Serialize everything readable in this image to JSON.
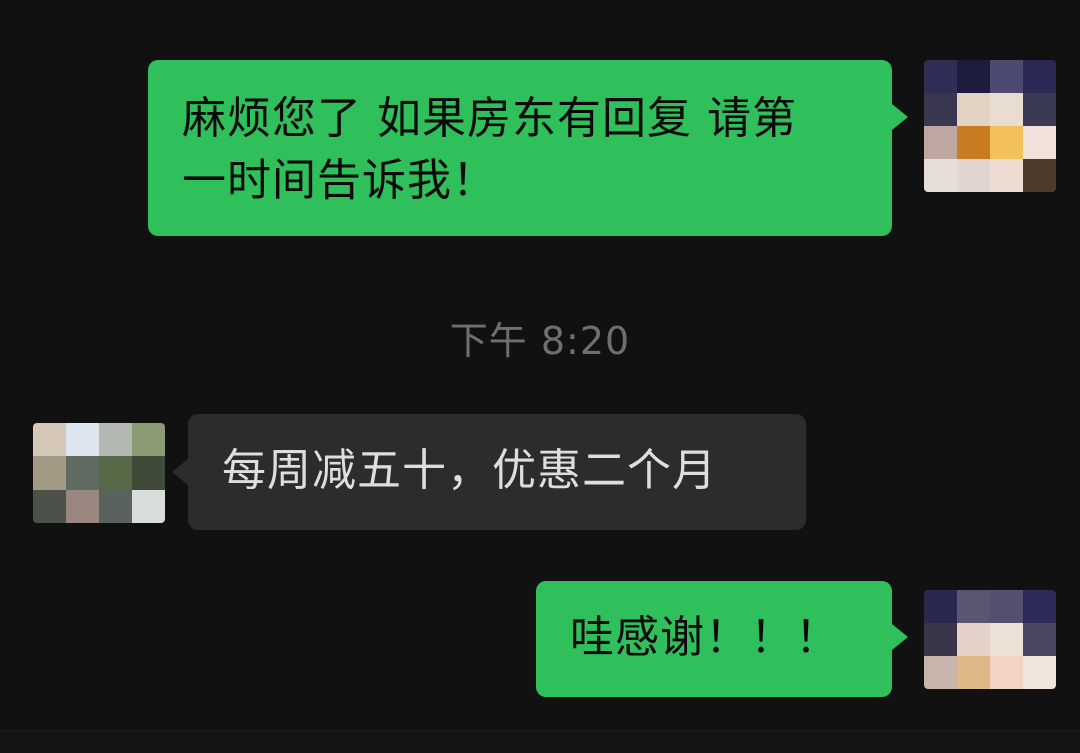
{
  "messages": [
    {
      "direction": "outgoing",
      "text_line1": "麻烦您了 如果房东有回复 请第",
      "text_line2": "一时间告诉我！"
    },
    {
      "direction": "incoming",
      "text": "每周减五十，优惠二个月"
    },
    {
      "direction": "outgoing",
      "text": "哇感谢！！！"
    }
  ],
  "timestamp": "下午 8:20",
  "colors": {
    "background": "#111111",
    "outgoing_bubble": "#2fbf5b",
    "incoming_bubble": "#2c2c2c",
    "timestamp_text": "#6f6f6f"
  }
}
